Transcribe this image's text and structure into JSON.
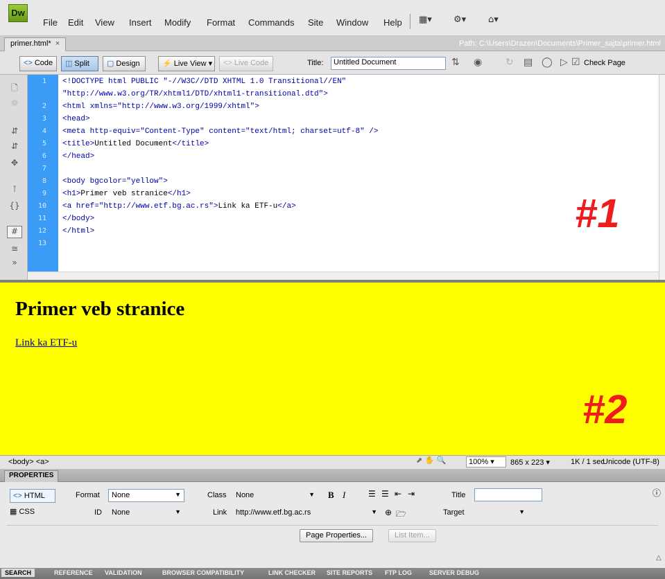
{
  "app": {
    "logo": "Dw"
  },
  "menu": [
    "File",
    "Edit",
    "View",
    "Insert",
    "Modify",
    "Format",
    "Commands",
    "Site",
    "Window",
    "Help"
  ],
  "menu_icons": {
    "layout": "▦▾",
    "extend": "⚙▾",
    "site": "⌂▾"
  },
  "tab": {
    "label": "primer.html*",
    "close": "×"
  },
  "path": "Path: C:\\Users\\Drazen\\Documents\\Primer_sajta\\primer.html",
  "toolbar": {
    "code": "Code",
    "split": "Split",
    "design": "Design",
    "live_view": "Live View",
    "live_code": "Live Code",
    "title_label": "Title:",
    "title_value": "Untitled Document",
    "check_page": "Check Page"
  },
  "code": {
    "line_numbers": [
      "1",
      "2",
      "3",
      "4",
      "5",
      "6",
      "7",
      "8",
      "9",
      "10",
      "11",
      "12",
      "13"
    ],
    "lines": [
      "<!DOCTYPE html PUBLIC \"-//W3C//DTD XHTML 1.0 Transitional//EN\"",
      "\"http://www.w3.org/TR/xhtml1/DTD/xhtml1-transitional.dtd\">",
      "<html xmlns=\"http://www.w3.org/1999/xhtml\">",
      "<head>",
      "<meta http-equiv=\"Content-Type\" content=\"text/html; charset=utf-8\" />",
      "<title>",
      "Untitled Document",
      "</title>",
      "</head>",
      "<body bgcolor=\"yellow\">",
      "<h1>",
      "Primer veb stranice",
      "</h1>",
      "<a href=\"http://www.etf.bg.ac.rs\">",
      "Link ka ETF-u",
      "</a>",
      "</body>",
      "</html>"
    ]
  },
  "annotations": {
    "code_marker": "#1",
    "design_marker": "#2"
  },
  "design": {
    "background": "#ffff00",
    "heading": "Primer veb stranice",
    "link": "Link ka ETF-u"
  },
  "status": {
    "tags": "<body> <a>",
    "zoom": "100%",
    "dimensions": "865 x 223",
    "download": "1K / 1 sec",
    "encoding": "Unicode (UTF-8)"
  },
  "properties": {
    "header": "PROPERTIES",
    "html_btn": "HTML",
    "css_btn": "CSS",
    "format_label": "Format",
    "format_value": "None",
    "class_label": "Class",
    "class_value": "None",
    "id_label": "ID",
    "id_value": "None",
    "link_label": "Link",
    "link_value": "http://www.etf.bg.ac.rs",
    "title_label": "Title",
    "target_label": "Target",
    "page_properties": "Page Properties...",
    "list_item": "List Item..."
  },
  "bottom_tabs": [
    "SEARCH",
    "REFERENCE",
    "VALIDATION",
    "BROWSER COMPATIBILITY",
    "LINK CHECKER",
    "SITE REPORTS",
    "FTP LOG",
    "SERVER DEBUG"
  ],
  "colors": {
    "gutter": "#3b9cf5",
    "code_text": "#0000a8",
    "marker": "#ee1c1c",
    "design_bg": "#ffff00"
  }
}
